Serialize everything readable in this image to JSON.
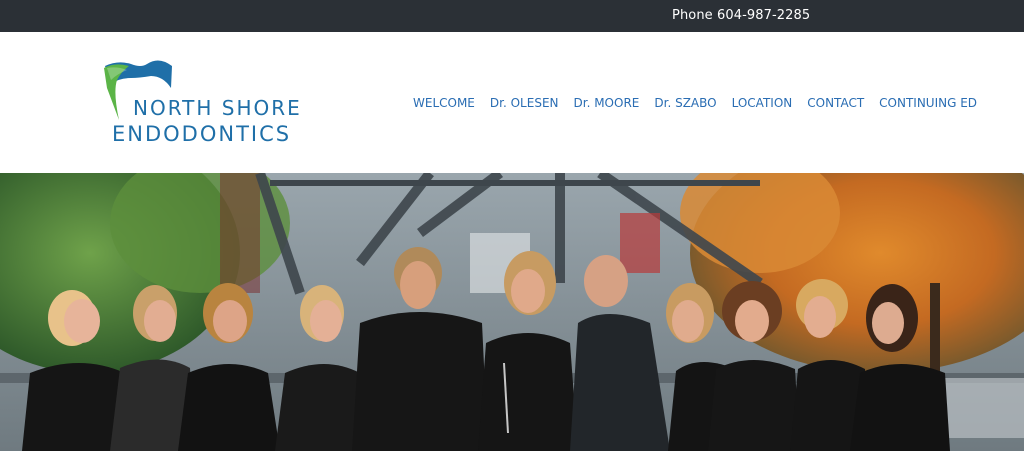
{
  "topbar": {
    "phone": "Phone 604-987-2285"
  },
  "brand": {
    "line1": "NORTH SHORE",
    "line2": "ENDODONTICS"
  },
  "nav": {
    "items": [
      "WELCOME",
      "Dr. OLESEN",
      "Dr. MOORE",
      "Dr. SZABO",
      "LOCATION",
      "CONTACT",
      "CONTINUING ED"
    ]
  },
  "colors": {
    "topbar": "#2b3036",
    "nav": "#2a6db3",
    "brand_blue": "#1f6fa8",
    "brand_green": "#5bb447"
  }
}
